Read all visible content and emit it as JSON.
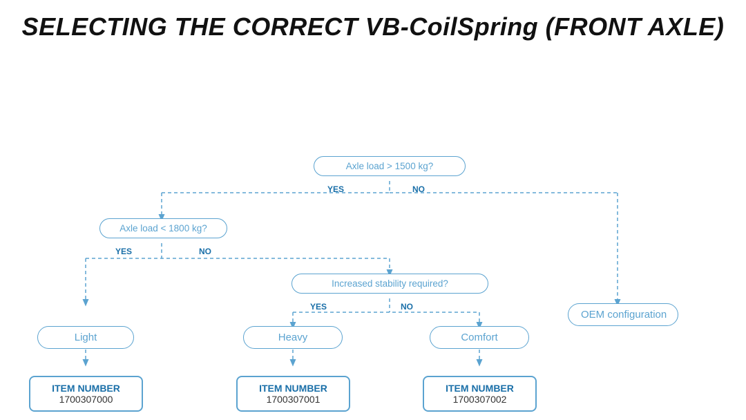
{
  "title": "SELECTING THE CORRECT VB-CoilSpring (FRONT AXLE)",
  "diagram": {
    "decisions": [
      {
        "id": "d1",
        "text": "Axle load > 1500 kg?",
        "yes_label": "YES",
        "no_label": "NO"
      },
      {
        "id": "d2",
        "text": "Axle load < 1800 kg?",
        "yes_label": "YES",
        "no_label": "NO"
      },
      {
        "id": "d3",
        "text": "Increased stability required?",
        "yes_label": "YES",
        "no_label": "NO"
      }
    ],
    "results": [
      {
        "id": "r1",
        "text": "Light"
      },
      {
        "id": "r2",
        "text": "Heavy"
      },
      {
        "id": "r3",
        "text": "Comfort"
      },
      {
        "id": "r4",
        "text": "OEM configuration"
      }
    ],
    "items": [
      {
        "id": "i1",
        "label": "ITEM NUMBER",
        "number": "1700307000"
      },
      {
        "id": "i2",
        "label": "ITEM NUMBER",
        "number": "1700307001"
      },
      {
        "id": "i3",
        "label": "ITEM NUMBER",
        "number": "1700307002"
      }
    ]
  }
}
